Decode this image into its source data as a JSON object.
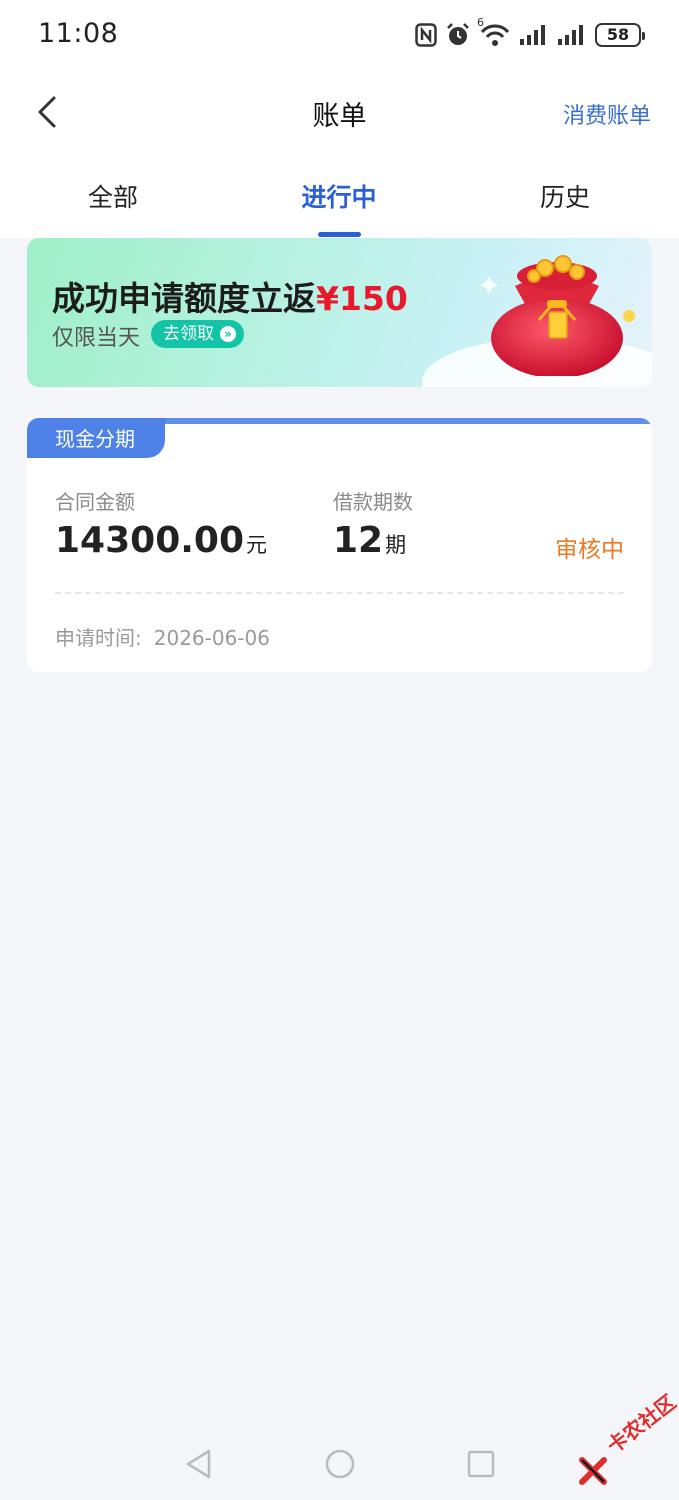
{
  "status_bar": {
    "time": "11:08",
    "wifi_badge": "6",
    "battery": "58",
    "icons": [
      "nfc-icon",
      "alarm-icon",
      "wifi-icon",
      "signal-icon",
      "signal-icon",
      "battery-icon"
    ]
  },
  "nav": {
    "title": "账单",
    "right_link": "消费账单",
    "back_icon": "chevron-left-icon"
  },
  "tabs": [
    {
      "label": "全部",
      "active": false
    },
    {
      "label": "进行中",
      "active": true
    },
    {
      "label": "历史",
      "active": false
    }
  ],
  "banner": {
    "title_prefix": "成功申请额度立返",
    "title_amount": "¥150",
    "subtitle": "仅限当天",
    "cta": "去领取",
    "image": "red-money-bag-icon"
  },
  "loan": {
    "tag": "现金分期",
    "amount_label": "合同金额",
    "amount_value": "14300.00",
    "amount_unit": "元",
    "periods_label": "借款期数",
    "periods_value": "12",
    "periods_unit": "期",
    "status": "审核中",
    "apply_time_label": "申请时间:",
    "apply_time_value": "2026-06-06"
  },
  "watermark": "卡农社区",
  "colors": {
    "accent_blue": "#2b5fd9",
    "link_blue": "#3a6fd8",
    "status_orange": "#ea7a24",
    "price_red": "#e8192c",
    "cta_green": "#13c4a6",
    "background": "#f5f6fa"
  }
}
